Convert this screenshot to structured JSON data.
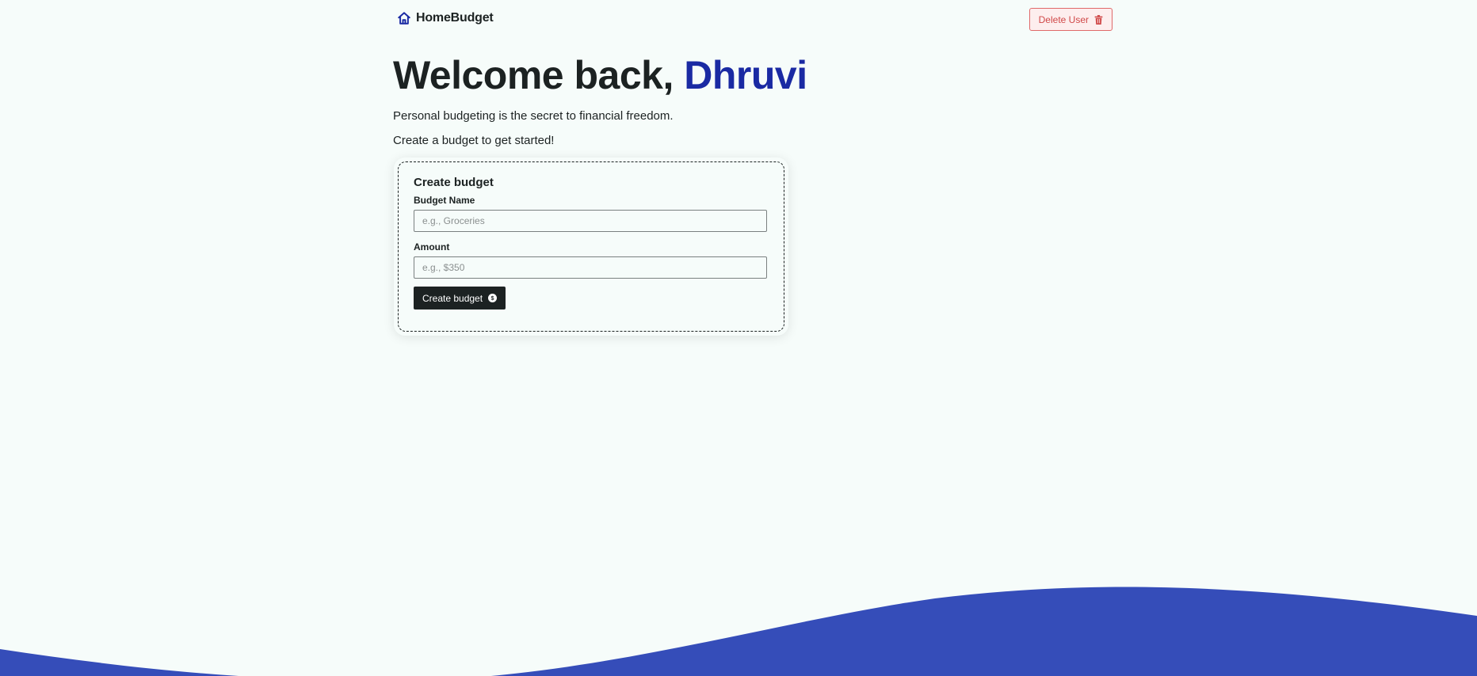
{
  "brand": {
    "name": "HomeBudget",
    "icon": "home-icon",
    "color": "#1a2aa3"
  },
  "header": {
    "delete_user_label": "Delete User",
    "delete_icon": "trash-icon"
  },
  "welcome": {
    "prefix": "Welcome back, ",
    "user_name": "Dhruvi",
    "tagline": "Personal budgeting is the secret to financial freedom.",
    "prompt": "Create a budget to get started!"
  },
  "create_budget_form": {
    "title": "Create budget",
    "name_label": "Budget Name",
    "name_placeholder": "e.g., Groceries",
    "name_value": "",
    "amount_label": "Amount",
    "amount_placeholder": "e.g., $350",
    "amount_value": "",
    "submit_label": "Create budget",
    "submit_icon": "dollar-coin-icon"
  },
  "colors": {
    "background": "#f6fcfa",
    "accent": "#1a2aa3",
    "wave": "#354db9",
    "danger": "#d04848",
    "dark": "#1c2222"
  }
}
